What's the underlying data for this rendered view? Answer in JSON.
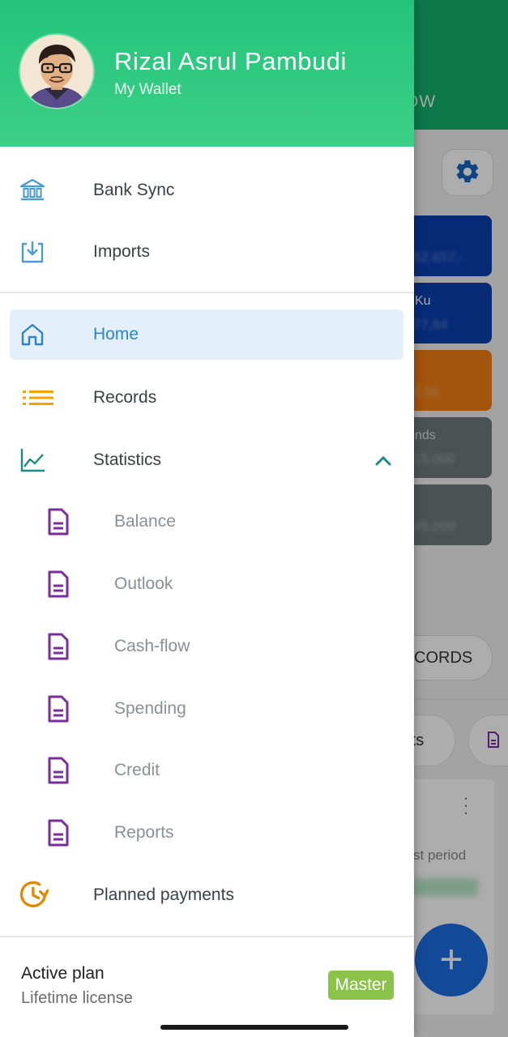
{
  "background": {
    "tab_fragment": "OW",
    "accounts": [
      {
        "name": "",
        "color": "#0b3fb0"
      },
      {
        "name": "Ku",
        "color": "#0b3fb0"
      },
      {
        "name": "",
        "color": "#f07d14"
      },
      {
        "name": "nds",
        "color": "#6e7a7a"
      },
      {
        "name": "",
        "color": "#6e7a7a"
      }
    ],
    "records_button_fragment": "CORDS",
    "chip_fragment": "rts",
    "period_fragment": "st period",
    "fab_label": "+"
  },
  "drawer": {
    "user_name": "Rizal Asrul Pambudi",
    "wallet_name": "My Wallet",
    "top_items": [
      {
        "label": "Bank Sync",
        "icon": "bank-icon"
      },
      {
        "label": "Imports",
        "icon": "import-icon"
      }
    ],
    "nav_items": {
      "home": {
        "label": "Home",
        "icon": "home-icon",
        "active": true
      },
      "records": {
        "label": "Records",
        "icon": "list-icon"
      },
      "statistics": {
        "label": "Statistics",
        "icon": "chart-icon",
        "expanded": true
      }
    },
    "statistics_children": [
      {
        "label": "Balance",
        "icon": "document-icon"
      },
      {
        "label": "Outlook",
        "icon": "document-icon"
      },
      {
        "label": "Cash-flow",
        "icon": "document-icon"
      },
      {
        "label": "Spending",
        "icon": "document-icon"
      },
      {
        "label": "Credit",
        "icon": "document-icon"
      },
      {
        "label": "Reports",
        "icon": "document-icon"
      }
    ],
    "planned_payments": {
      "label": "Planned payments",
      "icon": "clock-refresh-icon"
    },
    "plan": {
      "title": "Active plan",
      "subtitle": "Lifetime license",
      "badge": "Master"
    }
  },
  "colors": {
    "header_green": "#2ccb7e",
    "active_blue": "#2c85c8",
    "document_purple": "#7b2d9e",
    "list_orange": "#f5a300",
    "clock_orange": "#e08a00",
    "chart_teal": "#1e8a86",
    "badge_green": "#8bc34a",
    "fab_blue": "#1d6de0"
  }
}
